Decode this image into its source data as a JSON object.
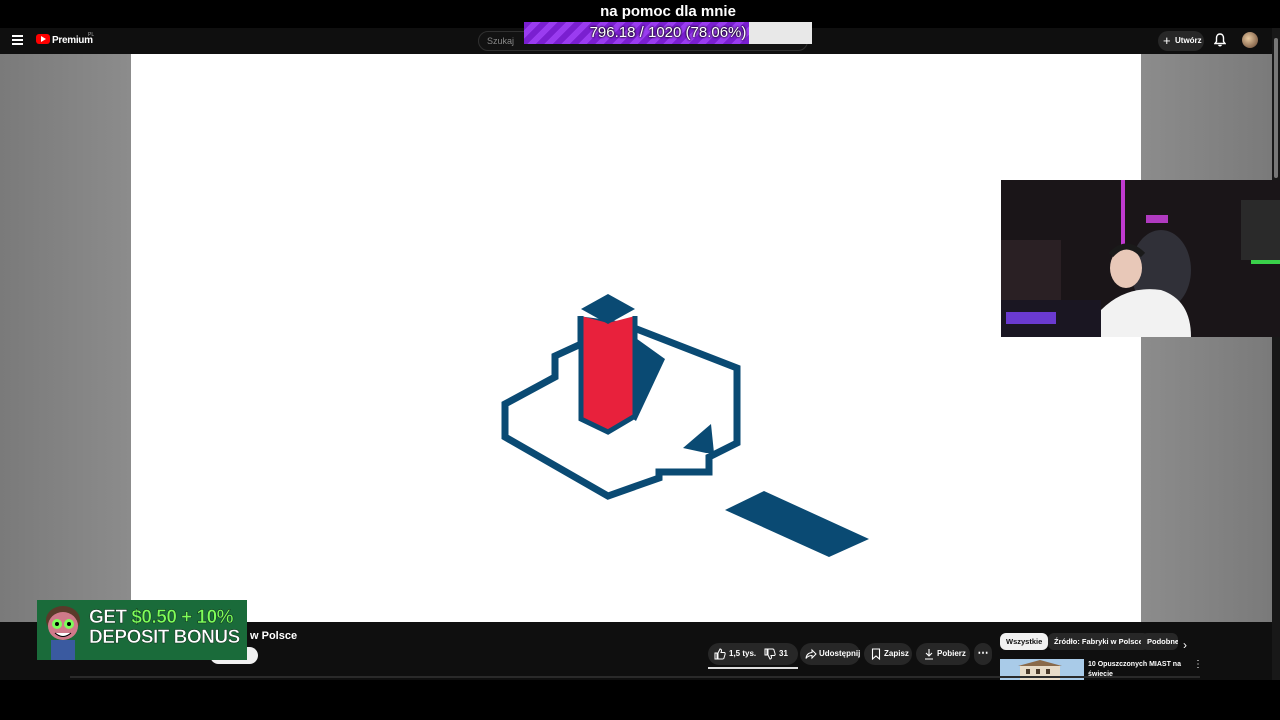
{
  "stream_overlay": {
    "goal_title": "na pomoc dla mnie",
    "goal_text": "796.18 / 1020 (78.06%)",
    "goal_fraction": 0.7806,
    "fill_color": "#8a2be2"
  },
  "header": {
    "menu_icon": "hamburger-menu-icon",
    "logo_label": "Premium",
    "logo_superscript": "PL",
    "search_placeholder": "Szukaj",
    "create_label": "Utwórz",
    "bell_icon": "notification-bell-icon"
  },
  "video": {
    "logo_colors": {
      "navy": "#0a4a73",
      "red": "#e8213c",
      "background": "#ffffff"
    }
  },
  "below_video": {
    "title_fragment": "w Polsce",
    "ad": {
      "line1_prefix": "GET ",
      "line1_highlight": "$0.50 + 10%",
      "line2": "DEPOSIT BONUS"
    },
    "likes": "1,5 tys.",
    "dislikes": "31",
    "share_label": "Udostępnij",
    "save_label": "Zapisz",
    "download_label": "Pobierz",
    "more_icon": "more-horizontal-icon"
  },
  "recommendations": {
    "chips": [
      "Wszystkie",
      "Źródło: Fabryki w Polsce",
      "Podobne"
    ],
    "active_chip": "Wszystkie",
    "item_title": "10 Opuszczonych MIAST na świecie"
  }
}
